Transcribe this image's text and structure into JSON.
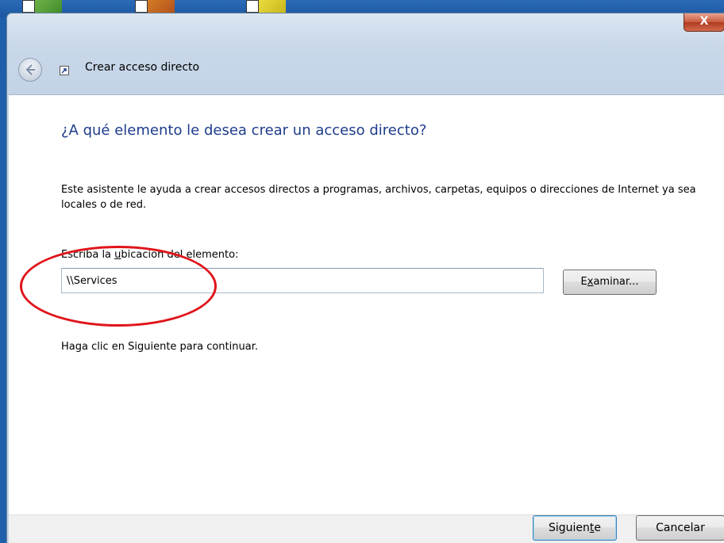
{
  "window": {
    "title": "Crear acceso directo",
    "close_label": "X"
  },
  "main": {
    "heading": "¿A qué elemento le desea crear un acceso directo?",
    "description": "Este asistente le ayuda a crear accesos directos a programas, archivos, carpetas, equipos o direcciones de Internet ya sea locales o de red.",
    "location_label_pre": "Escriba la ",
    "location_label_accel": "u",
    "location_label_post": "bicación del elemento:",
    "location_value": "\\\\Services",
    "browse_pre": "E",
    "browse_accel": "x",
    "browse_post": "aminar...",
    "continue_hint": "Haga clic en Siguiente para continuar."
  },
  "footer": {
    "next_pre": "Siguien",
    "next_accel": "t",
    "next_post": "e",
    "cancel_label": "Cancelar"
  },
  "colors": {
    "heading": "#1e3c8c",
    "annotation": "#e0141a"
  }
}
